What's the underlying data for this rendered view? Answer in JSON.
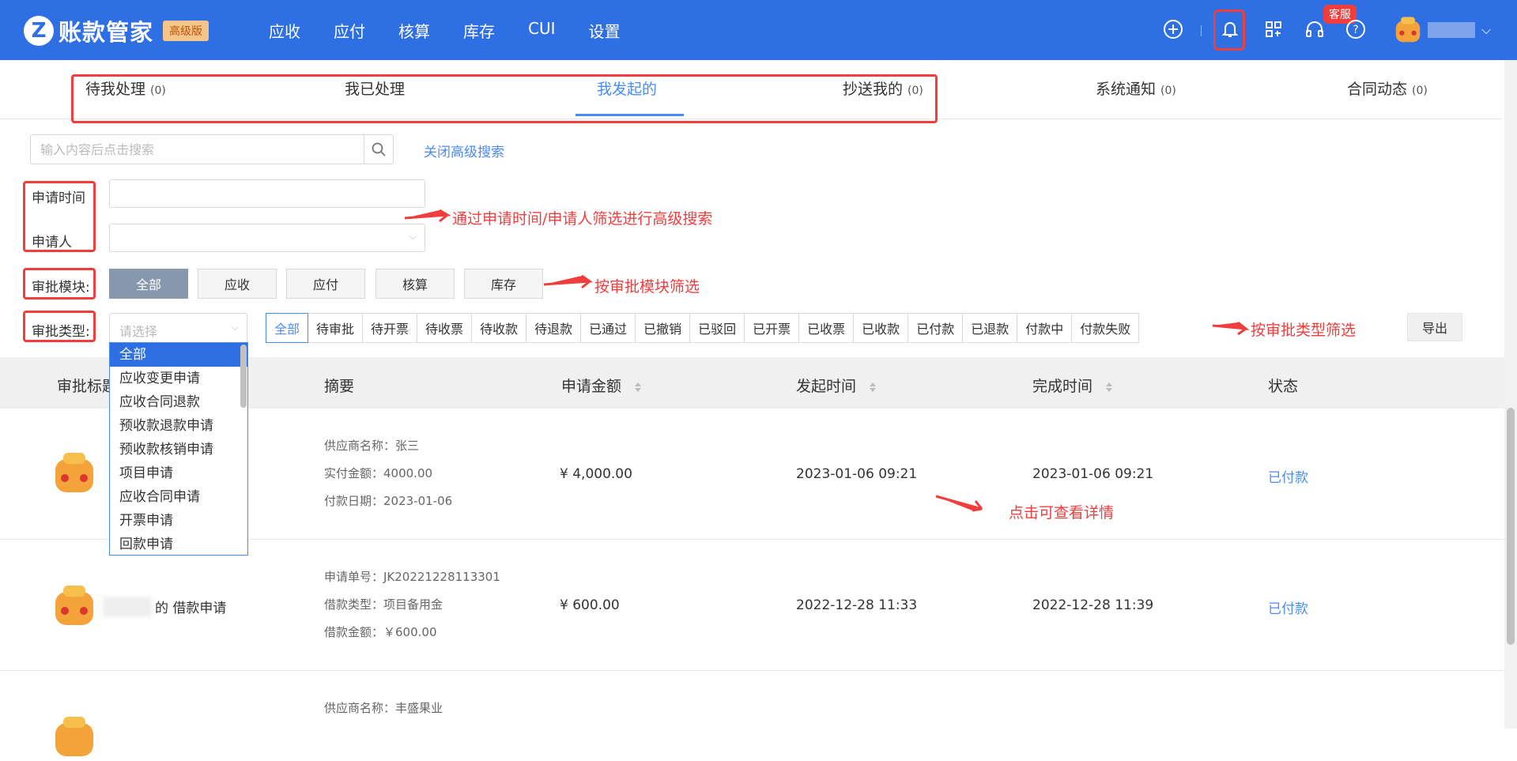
{
  "header": {
    "logo_letter": "Z",
    "app_name": "账款管家",
    "edition_badge": "高级版",
    "nav": [
      "应收",
      "应付",
      "核算",
      "库存",
      "CUI",
      "设置"
    ],
    "support_badge": "客服",
    "icons": [
      "plus-circle-icon",
      "bell-icon",
      "grid-icon",
      "headset-icon",
      "help-icon"
    ],
    "accent": "#2f6fe4"
  },
  "tabs": [
    {
      "label": "待我处理",
      "count": "(0)"
    },
    {
      "label": "我已处理",
      "count": ""
    },
    {
      "label": "我发起的",
      "count": ""
    },
    {
      "label": "抄送我的",
      "count": "(0)"
    },
    {
      "label": "系统通知",
      "count": "(0)"
    },
    {
      "label": "合同动态",
      "count": "(0)"
    }
  ],
  "active_tab": "我发起的",
  "search": {
    "placeholder": "输入内容后点击搜索",
    "toggle_label": "关闭高级搜索"
  },
  "filters": {
    "apply_time_label": "申请时间",
    "applicant_label": "申请人",
    "module_label": "审批模块:",
    "modules": [
      "全部",
      "应收",
      "应付",
      "核算",
      "库存"
    ],
    "type_label": "审批类型:",
    "type_placeholder": "请选择",
    "types": [
      "全部",
      "待审批",
      "待开票",
      "待收票",
      "待收款",
      "待退款",
      "已通过",
      "已撤销",
      "已驳回",
      "已开票",
      "已收票",
      "已收款",
      "已付款",
      "已退款",
      "付款中",
      "付款失败"
    ],
    "export_label": "导出"
  },
  "annotations": {
    "advanced_search": "通过申请时间/申请人筛选进行高级搜索",
    "module_filter": "按审批模块筛选",
    "type_filter": "按审批类型筛选",
    "view_detail": "点击可查看详情"
  },
  "dropdown": {
    "items": [
      "全部",
      "应收变更申请",
      "应收合同退款",
      "预收款退款申请",
      "预收款核销申请",
      "项目申请",
      "应收合同申请",
      "开票申请",
      "回款申请"
    ],
    "selected": "全部"
  },
  "table": {
    "columns": [
      "审批标题",
      "摘要",
      "申请金额",
      "发起时间",
      "完成时间",
      "状态"
    ],
    "rows": [
      {
        "title": "",
        "summary": [
          "供应商名称：张三",
          "实付金额：4000.00",
          "付款日期：2023-01-06"
        ],
        "amount": "¥ 4,000.00",
        "start": "2023-01-06 09:21",
        "end": "2023-01-06 09:21",
        "status": "已付款"
      },
      {
        "title": "的 借款申请",
        "summary": [
          "申请单号：JK20221228113301",
          "借款类型：项目备用金",
          "借款金额：￥600.00"
        ],
        "amount": "¥ 600.00",
        "start": "2022-12-28 11:33",
        "end": "2022-12-28 11:39",
        "status": "已付款"
      },
      {
        "title": "",
        "summary": [
          "供应商名称：丰盛果业"
        ],
        "amount": "",
        "start": "",
        "end": "",
        "status": ""
      }
    ]
  }
}
